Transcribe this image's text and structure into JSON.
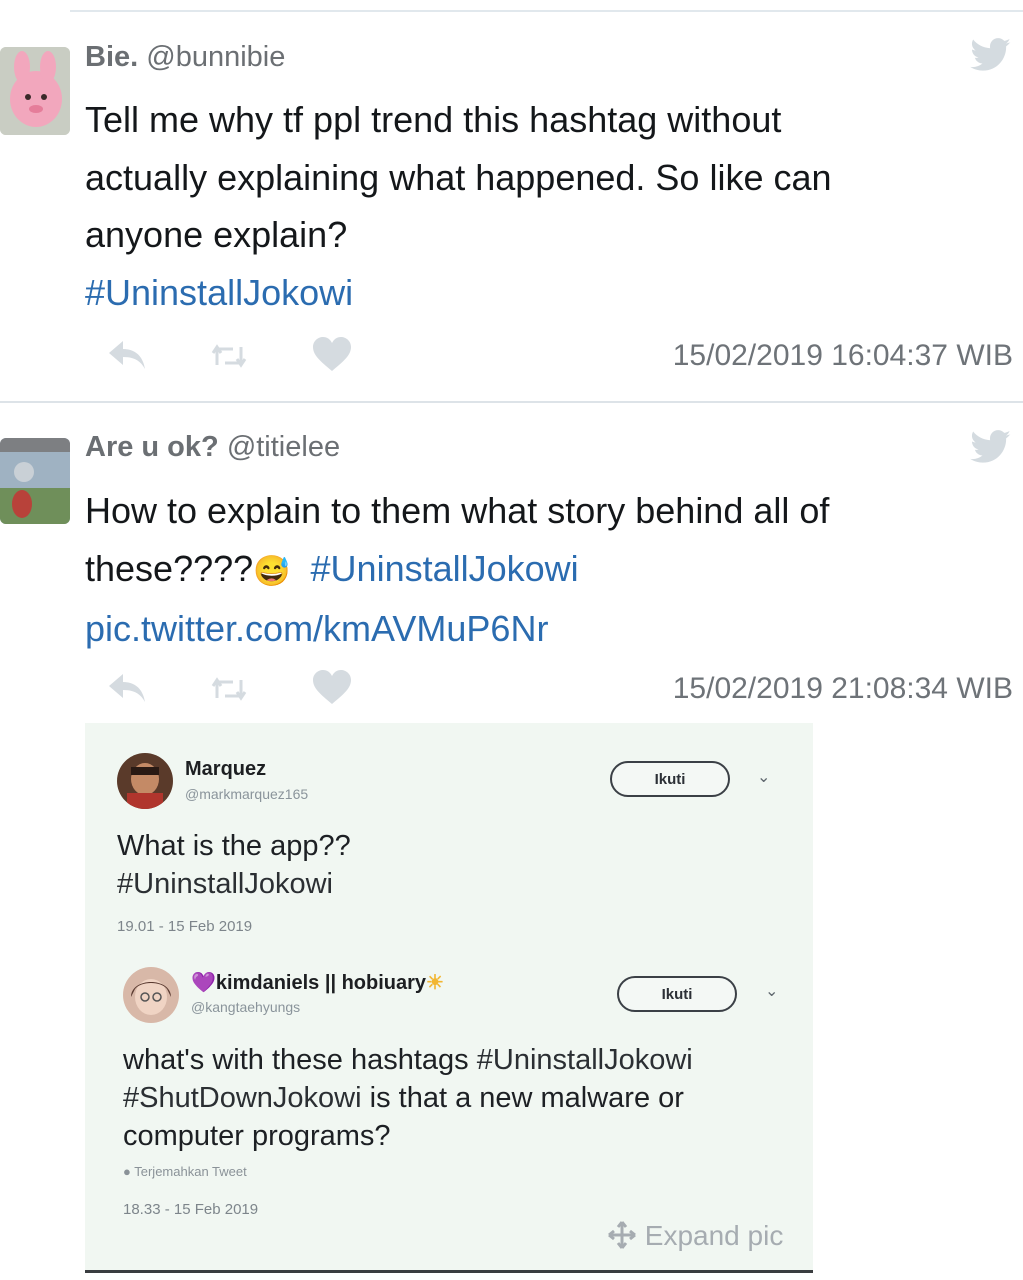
{
  "tweets": [
    {
      "display_name": "Bie.",
      "handle": "@bunnibie",
      "lines": [
        "Tell me why tf ppl trend this hashtag without",
        "actually explaining what happened. So like can",
        "anyone explain?"
      ],
      "hashtag": "#UninstallJokowi",
      "timestamp": "15/02/2019 16:04:37 WIB"
    },
    {
      "display_name": "Are u ok?",
      "handle": "@titielee",
      "line1": "How to explain to them what story behind all of",
      "line2_prefix": "these????",
      "emoji": "😅",
      "hashtag": "#UninstallJokowi",
      "link": "pic.twitter.com/kmAVMuP6Nr",
      "timestamp": "15/02/2019 21:08:34 WIB"
    }
  ],
  "embedded": {
    "tweet1": {
      "name": "Marquez",
      "handle": "@markmarquez165",
      "follow": "Ikuti",
      "line1": "What is the app??",
      "hashtag": "#UninstallJokowi",
      "time": "19.01 - 15 Feb 2019"
    },
    "tweet2": {
      "name_prefix": "💜",
      "name": "kimdaniels || hobiuary",
      "name_suffix": "☀",
      "handle": "@kangtaehyungs",
      "follow": "Ikuti",
      "line1_text": "what's with these hashtags ",
      "line1_tag": "#UninstallJokowi",
      "line2_tag": "#ShutDownJokowi",
      "line2_text": " is that a new malware or",
      "line3": "computer programs?",
      "translate": "Terjemahkan Tweet",
      "time": "18.33 - 15 Feb 2019"
    },
    "expand_label": "Expand pic"
  },
  "icons": {
    "reply": "reply-icon",
    "retweet": "retweet-icon",
    "like": "heart-icon",
    "twitter": "twitter-bird-icon",
    "expand": "expand-icon",
    "chevron": "chevron-down-icon"
  },
  "colors": {
    "hashtag": "#2b6cb0",
    "icon": "#d3d9de",
    "embed_bg": "#f1f7f2"
  }
}
